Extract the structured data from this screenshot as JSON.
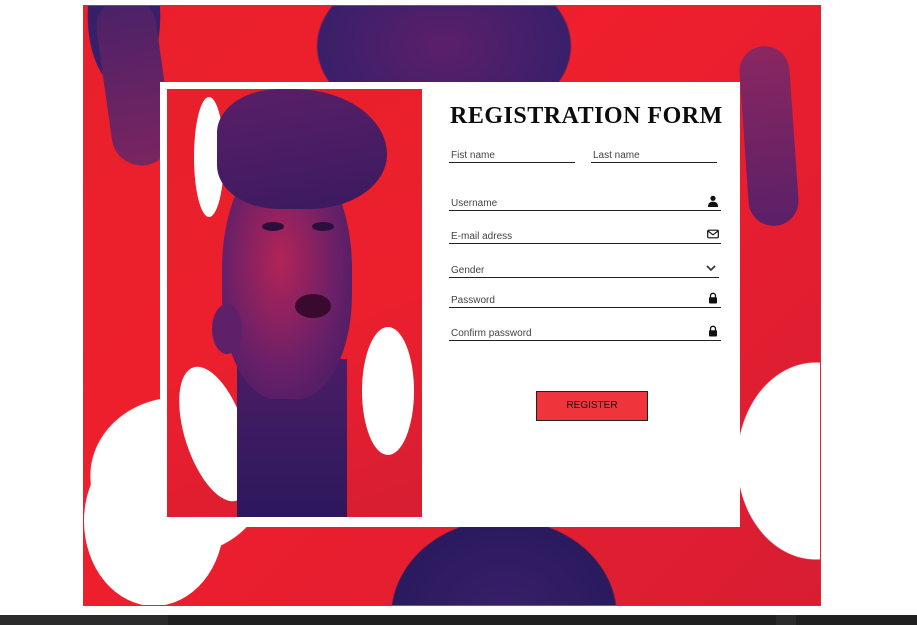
{
  "form": {
    "title": "REGISTRATION FORM",
    "first_name_placeholder": "Fist name",
    "last_name_placeholder": "Last name",
    "username_placeholder": "Username",
    "email_placeholder": "E-mail adress",
    "gender_placeholder": "Gender",
    "password_placeholder": "Password",
    "confirm_password_placeholder": "Confirm password",
    "register_label": "REGISTER"
  },
  "icons": {
    "username": "user-icon",
    "email": "envelope-icon",
    "gender": "chevron-down-icon",
    "password": "lock-icon",
    "confirm_password": "lock-icon"
  },
  "colors": {
    "accent_red": "#f0343b",
    "background_red": "#e8202c",
    "background_purple": "#3a1f6a"
  }
}
